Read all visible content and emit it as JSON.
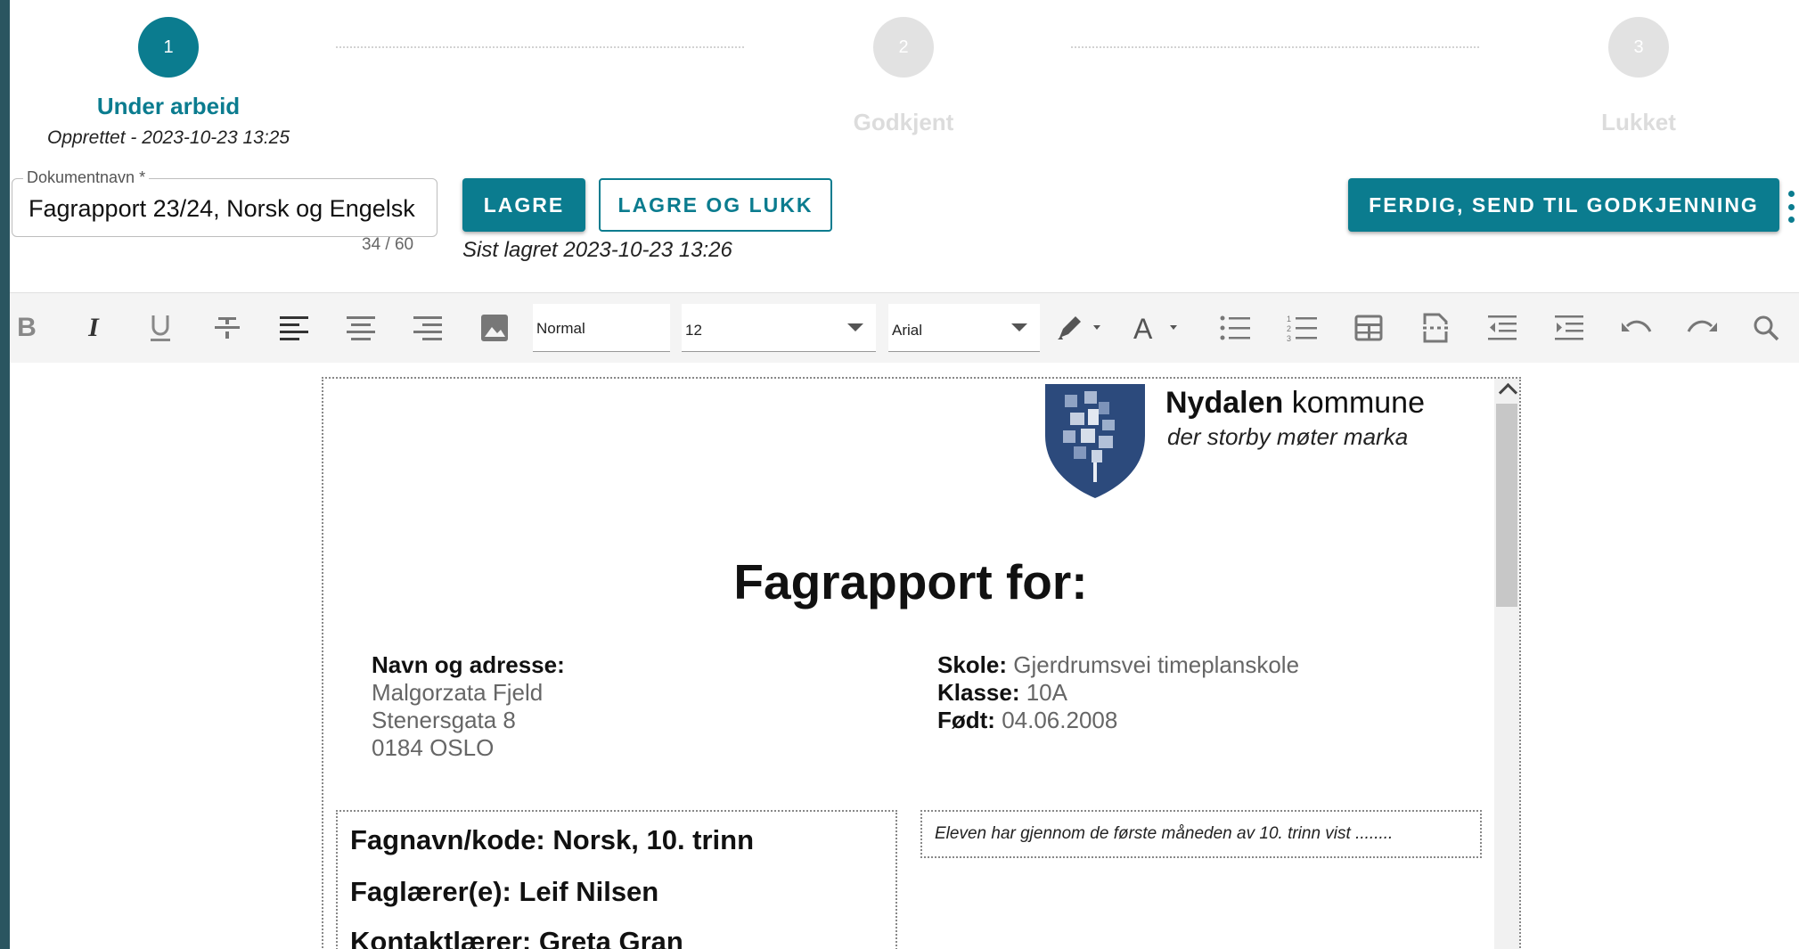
{
  "stepper": {
    "steps": [
      {
        "number": "1",
        "label": "Under arbeid",
        "subtitle": "Opprettet - 2023-10-23 13:25"
      },
      {
        "number": "2",
        "label": "Godkjent"
      },
      {
        "number": "3",
        "label": "Lukket"
      }
    ]
  },
  "docname": {
    "label": "Dokumentnavn *",
    "value": "Fagrapport 23/24, Norsk og Engelsk",
    "counter": "34 / 60"
  },
  "actions": {
    "save": "LAGRE",
    "save_close": "LAGRE OG LUKK",
    "last_saved": "Sist lagret 2023-10-23 13:26",
    "finish": "FERDIG, SEND TIL GODKJENNING"
  },
  "toolbar": {
    "style_value": "Normal",
    "size_value": "12",
    "font_value": "Arial",
    "icons": [
      "bold-icon",
      "italic-icon",
      "underline-icon",
      "strikethrough-icon",
      "align-left-icon",
      "align-center-icon",
      "align-right-icon",
      "image-icon",
      "highlight-icon",
      "font-color-icon",
      "bullet-list-icon",
      "numbered-list-icon",
      "table-icon",
      "page-break-icon",
      "outdent-icon",
      "indent-icon",
      "undo-icon",
      "redo-icon",
      "search-icon"
    ]
  },
  "document": {
    "org_name_bold": "Nydalen",
    "org_name_rest": " kommune",
    "org_tagline": "der storby møter marka",
    "title": "Fagrapport for:",
    "student": {
      "address_label": "Navn og adresse:",
      "name": "Malgorzata Fjeld",
      "street": "Stenersgata 8",
      "city": "0184 OSLO"
    },
    "school": {
      "school_label": "Skole:",
      "school_value": " Gjerdrumsvei timeplanskole",
      "class_label": "Klasse:",
      "class_value": " 10A",
      "born_label": "Født:",
      "born_value": " 04.06.2008"
    },
    "subject": {
      "subject_line": "Fagnavn/kode: Norsk, 10. trinn",
      "teacher_line": "Faglærer(e): Leif Nilsen",
      "contact_line": "Kontaktlærer: Greta Gran"
    },
    "comment": "Eleven har gjennom de første måneden av 10. trinn vist ........"
  },
  "colors": {
    "accent": "#0b7c8f",
    "inactive_step": "#e2e2e2",
    "frame": "#2a5560"
  }
}
